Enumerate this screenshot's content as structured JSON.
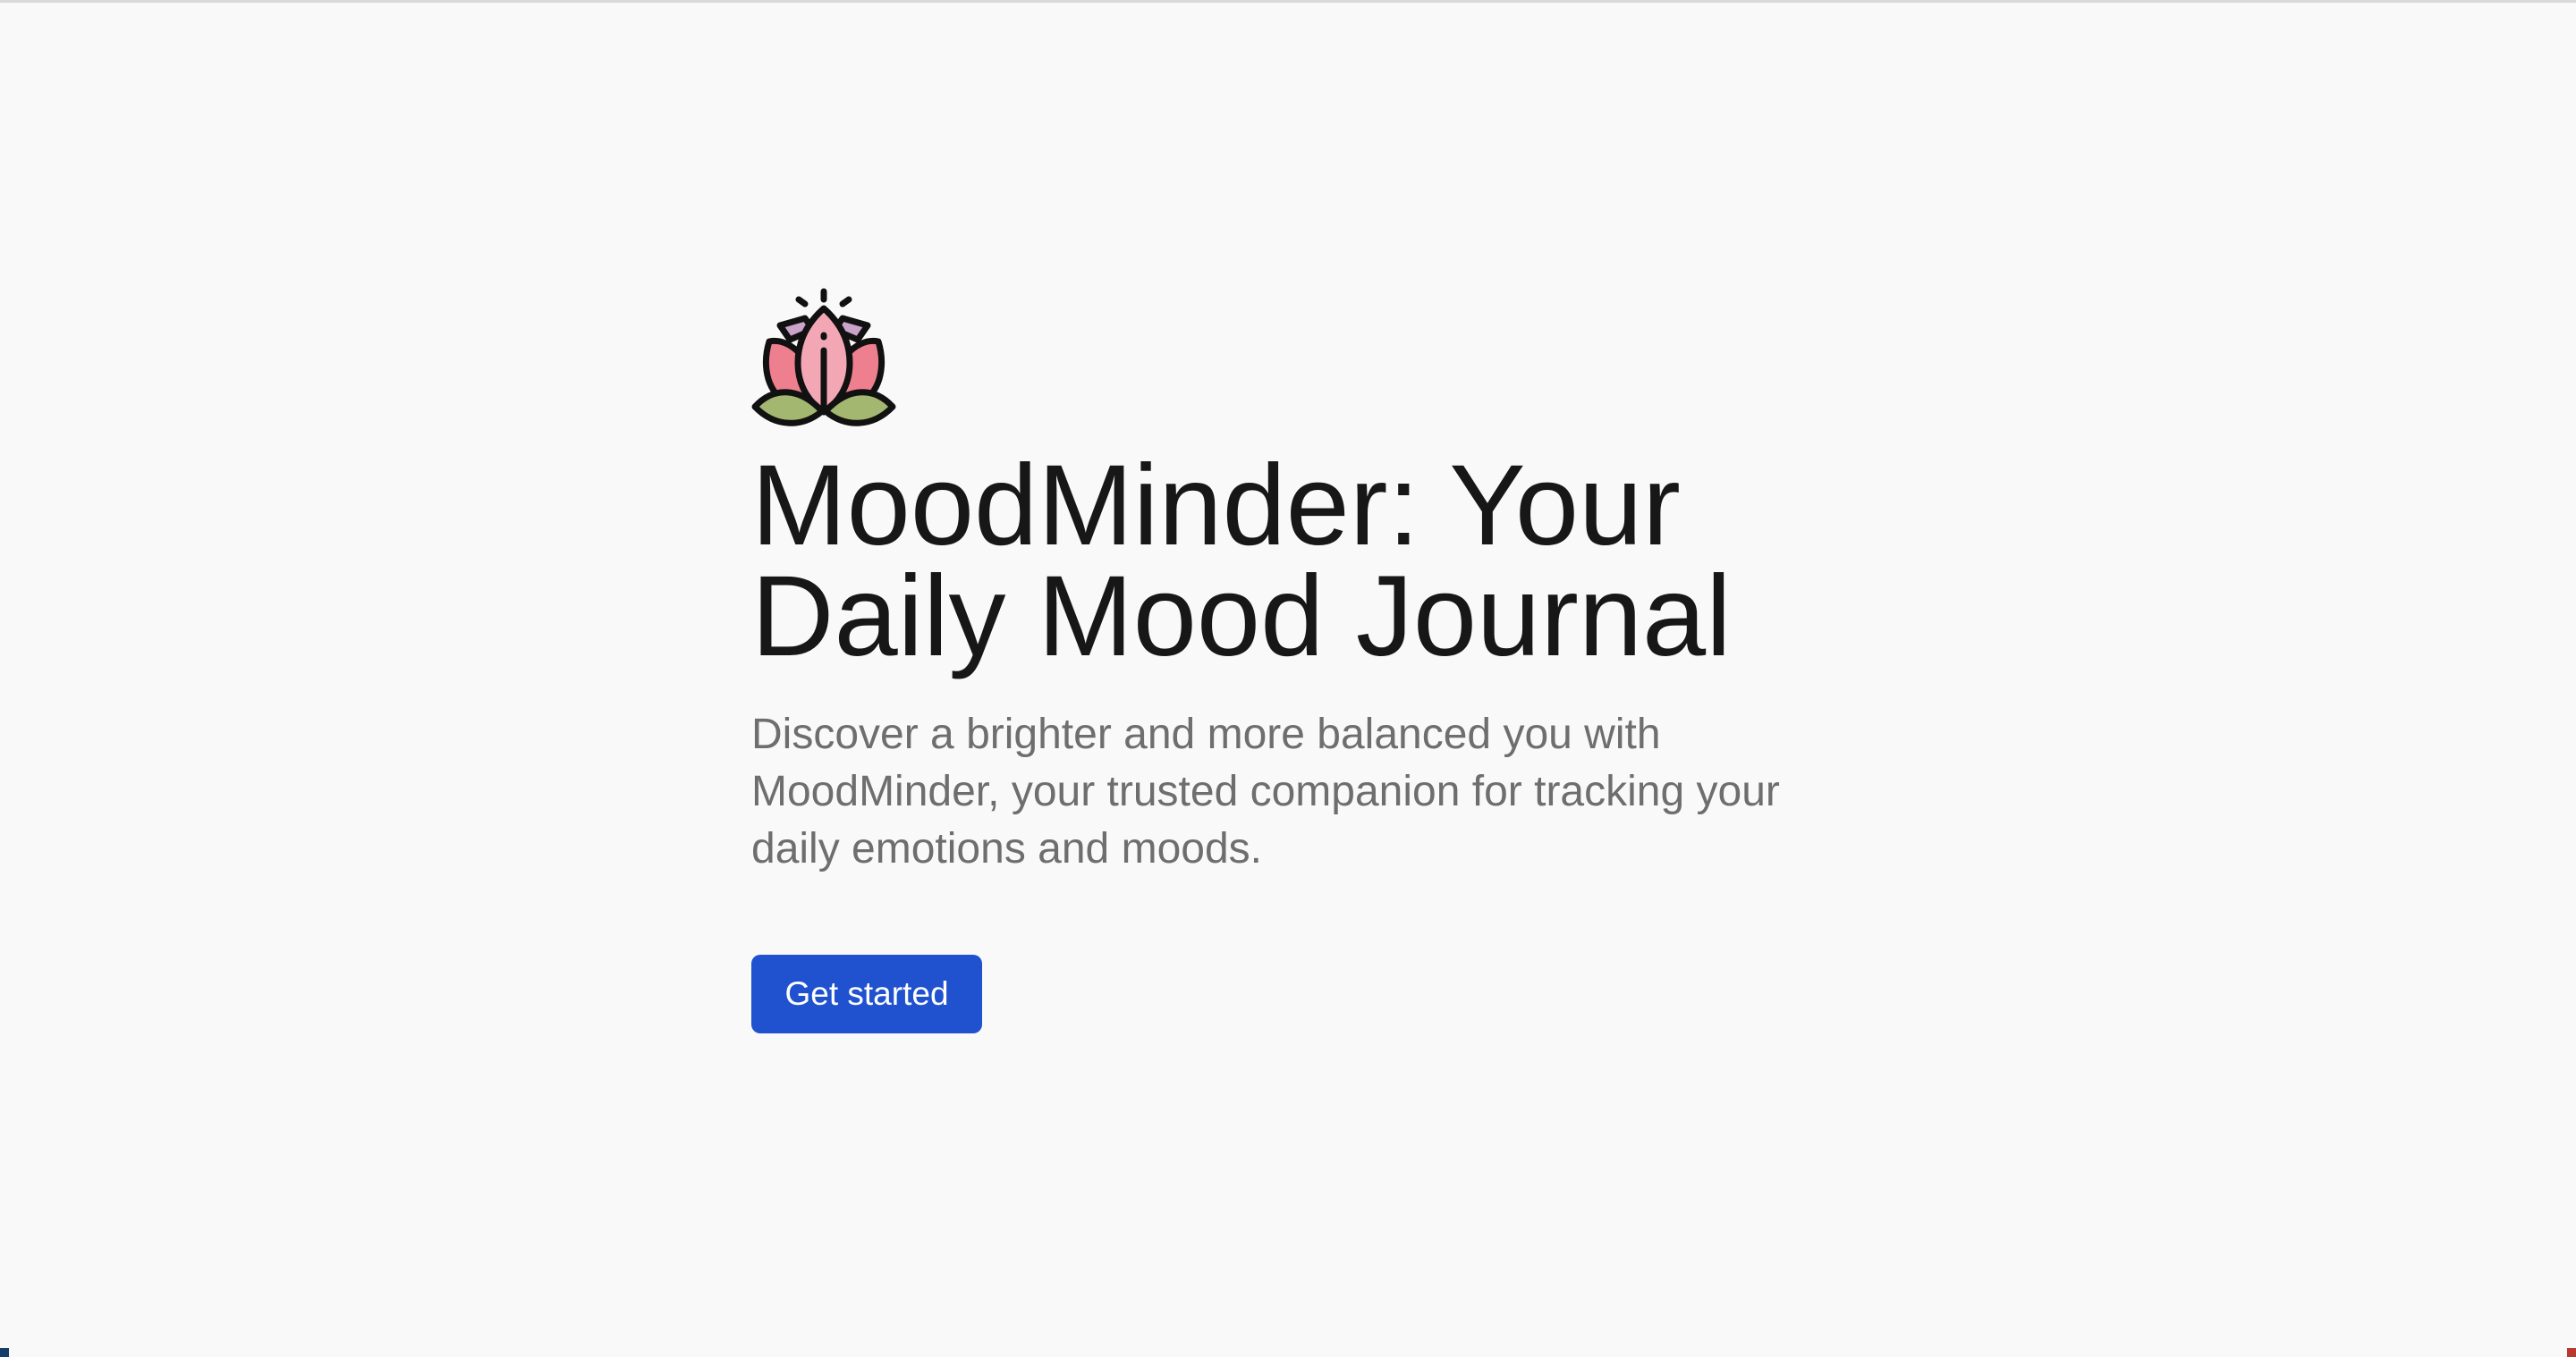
{
  "hero": {
    "logo_icon": "lotus-icon",
    "title": "MoodMinder: Your Daily Mood Journal",
    "subtitle": "Discover a brighter and more balanced you with MoodMinder, your trusted companion for tracking your daily emotions and moods.",
    "cta_label": "Get started"
  },
  "colors": {
    "background": "#f9f9f9",
    "title": "#171717",
    "subtitle": "#6e6e6e",
    "button": "#2052cf",
    "button_text": "#ffffff",
    "lotus_pink": "#ee7f8f",
    "lotus_light_pink": "#f3a7b5",
    "lotus_purple": "#c9a3c9",
    "lotus_green": "#a4b771"
  }
}
